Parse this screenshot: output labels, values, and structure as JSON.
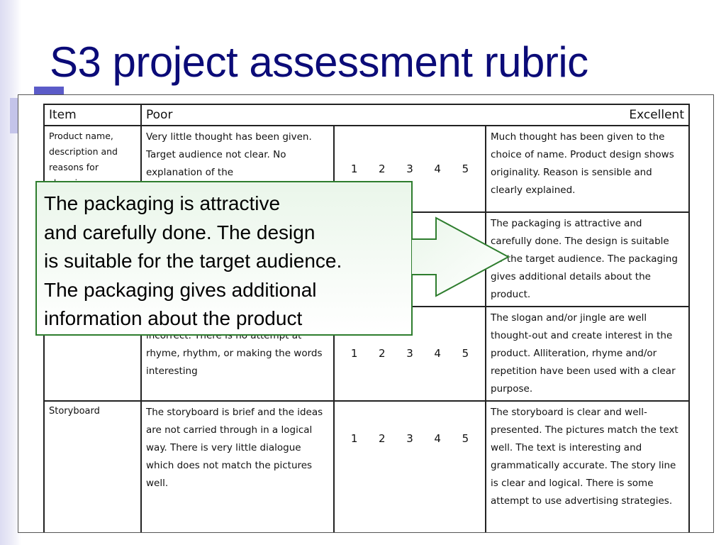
{
  "slide": {
    "title": "S3 project assessment rubric"
  },
  "rubric": {
    "header": {
      "item": "Item",
      "poor": "Poor",
      "excellent": "Excellent"
    },
    "scores": [
      "1",
      "2",
      "3",
      "4",
      "5"
    ],
    "rows": [
      {
        "item": "Product name, description and reasons for choosing",
        "poor": "Very little thought has been given. Target audience not clear. No explanation of the",
        "excellent": "Much thought has been given to the choice of name. Product design shows originality. Reason is sensible and clearly explained."
      },
      {
        "item": "",
        "poor": "",
        "excellent": "The packaging is attractive and carefully done. The design is suitable for the target audience. The packaging gives additional details about the product."
      },
      {
        "item": "",
        "poor": "incorrect. There is no attempt at rhyme, rhythm, or making the words interesting",
        "excellent": "The slogan and/or jingle are well thought-out and create interest in the product. Alliteration, rhyme and/or repetition have been used with a clear purpose."
      },
      {
        "item": "Storyboard",
        "poor": "The storyboard is brief and the ideas are not carried through in a logical way. There is very little dialogue which does not match the pictures well.",
        "excellent": "The storyboard is clear and well-presented. The pictures match the text well. The text is interesting and grammatically accurate. The story line is clear and logical. There is some attempt to use advertising strategies."
      }
    ]
  },
  "callout": {
    "lines": [
      "The packaging is attractive",
      "and carefully done. The design",
      "is suitable for the target audience.",
      "The packaging gives additional",
      "information about the product"
    ]
  },
  "colors": {
    "title": "#0b0b78",
    "callout_border": "#2e7d2e",
    "callout_fill": "#eaf6ea",
    "accent_square": "#5b5bc8"
  }
}
